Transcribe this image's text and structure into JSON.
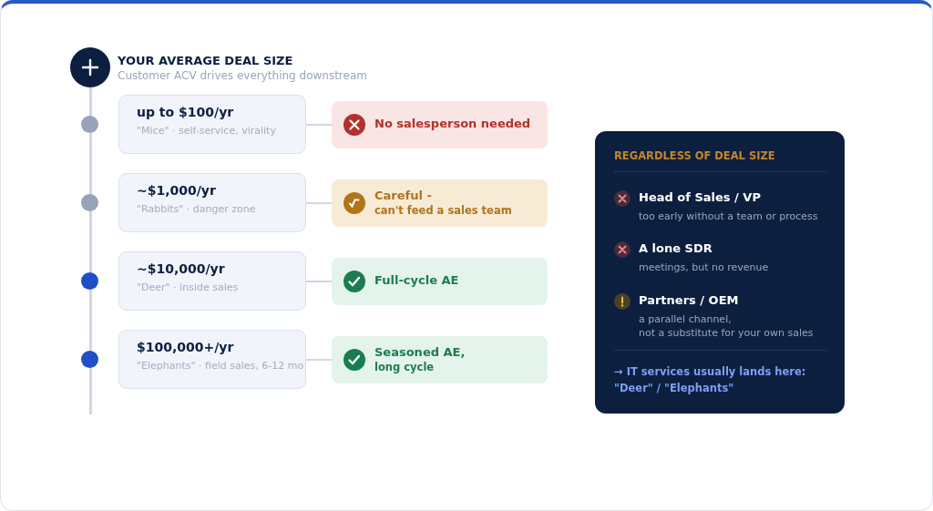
{
  "header": {
    "title": "YOUR AVERAGE DEAL SIZE",
    "subtitle": "Customer ACV drives everything downstream"
  },
  "tiers": [
    {
      "price": "up to $100/yr",
      "desc": "\"Mice\" · self-service, virality",
      "highlighted": false,
      "verdict": {
        "kind": "no",
        "lines": [
          "No salesperson needed"
        ]
      }
    },
    {
      "price": "~$1,000/yr",
      "desc": "\"Rabbits\" · danger zone",
      "highlighted": false,
      "verdict": {
        "kind": "caution",
        "lines": [
          "Careful -",
          "can't feed a sales team"
        ]
      }
    },
    {
      "price": "~$10,000/yr",
      "desc": "\"Deer\" · inside sales",
      "highlighted": true,
      "verdict": {
        "kind": "yes",
        "lines": [
          "Full-cycle AE"
        ]
      }
    },
    {
      "price": "$100,000+/yr",
      "desc": "\"Elephants\" · field sales, 6-12 mo",
      "highlighted": true,
      "verdict": {
        "kind": "yes",
        "lines": [
          "Seasoned AE,",
          "long cycle"
        ]
      }
    }
  ],
  "panel": {
    "title": "REGARDLESS OF DEAL SIZE",
    "items": [
      {
        "kind": "no",
        "title": "Head of Sales / VP",
        "desc": [
          "too early without a team or process"
        ]
      },
      {
        "kind": "no",
        "title": "A lone SDR",
        "desc": [
          "meetings, but no revenue"
        ]
      },
      {
        "kind": "warn",
        "title": "Partners / OEM",
        "desc": [
          "a parallel channel,",
          "not a substitute for your own sales"
        ]
      }
    ],
    "footer": [
      "→ IT services usually lands here:",
      "\"Deer\" / \"Elephants\""
    ]
  }
}
